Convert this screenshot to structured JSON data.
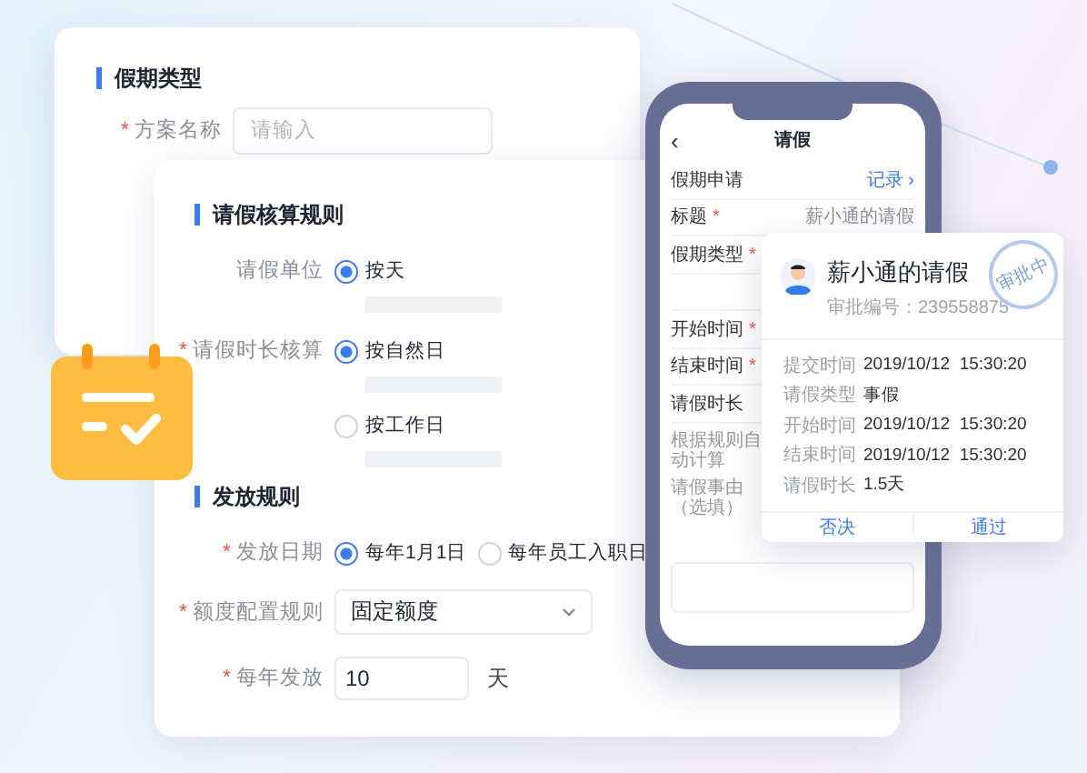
{
  "required_mark": "*",
  "leave_type_card": {
    "title": "假期类型",
    "fields": [
      {
        "label": "方案名称",
        "required": true,
        "placeholder": "请输入"
      }
    ]
  },
  "rules_card": {
    "sections": [
      {
        "title": "请假核算规则",
        "rows": [
          {
            "kind": "radio-stacked",
            "label": "请假单位",
            "required": false,
            "options": [
              {
                "label": "按天",
                "selected": true
              }
            ]
          },
          {
            "kind": "radio-stacked",
            "label": "请假时长核算",
            "required": true,
            "options": [
              {
                "label": "按自然日",
                "selected": true
              },
              {
                "label": "按工作日",
                "selected": false
              }
            ]
          }
        ]
      },
      {
        "title": "发放规则",
        "rows": [
          {
            "kind": "radio-inline",
            "label": "发放日期",
            "required": true,
            "options": [
              {
                "label": "每年1月1日",
                "selected": true
              },
              {
                "label": "每年员工入职日",
                "selected": false
              }
            ]
          },
          {
            "kind": "select",
            "label": "额度配置规则",
            "required": true,
            "value": "固定额度"
          },
          {
            "kind": "number",
            "label": "每年发放",
            "required": true,
            "value": "10",
            "unit": "天"
          }
        ]
      }
    ]
  },
  "phone": {
    "back": "‹",
    "title": "请假",
    "rows": [
      {
        "kind": "section",
        "label": "假期申请",
        "link": "记录 ›"
      },
      {
        "kind": "field",
        "label": "标题",
        "required": true,
        "value": "薪小通的请假"
      },
      {
        "kind": "field",
        "label": "假期类型",
        "required": true
      },
      {
        "kind": "blank"
      },
      {
        "kind": "field",
        "label": "开始时间",
        "required": true
      },
      {
        "kind": "field",
        "label": "结束时间",
        "required": true
      },
      {
        "kind": "field",
        "label": "请假时长",
        "required": false
      }
    ],
    "notes": [
      "根据规则自动计算",
      "请假事由（选填）"
    ]
  },
  "approval": {
    "title": "薪小通的请假",
    "serial_label": "审批编号：",
    "serial": "239558875",
    "status": "审批中",
    "details": [
      {
        "label": "提交时间",
        "value": "2019/10/12  15:30:20"
      },
      {
        "label": "请假类型",
        "value": "事假"
      },
      {
        "label": "开始时间",
        "value": "2019/10/12  15:30:20"
      },
      {
        "label": "结束时间",
        "value": "2019/10/12  15:30:20"
      },
      {
        "label": "请假时长",
        "value": "1.5天"
      }
    ],
    "actions": [
      {
        "label": "否决"
      },
      {
        "label": "通过"
      }
    ]
  }
}
